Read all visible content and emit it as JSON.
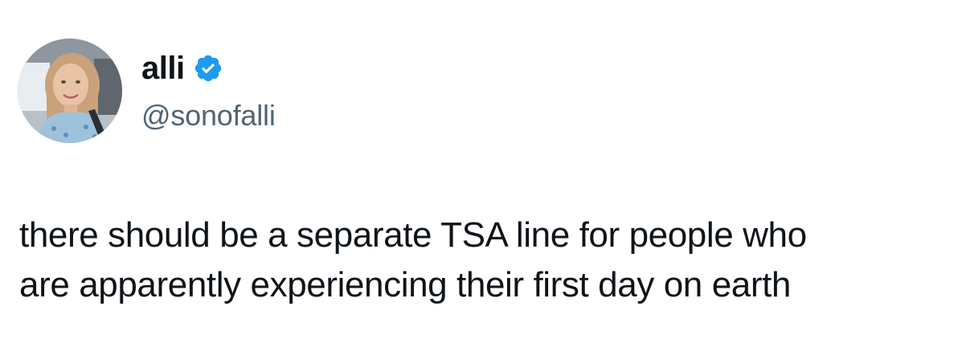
{
  "author": {
    "display_name": "alli",
    "handle": "@sonofalli",
    "verified": true,
    "avatar_icon": "profile-photo",
    "verified_icon": "verified-badge-icon",
    "verified_color": "#1d9bf0"
  },
  "tweet": {
    "lines": [
      "there should be a separate TSA line for people who",
      "are apparently experiencing their first day on earth"
    ]
  },
  "colors": {
    "text": "#0f1419",
    "secondary_text": "#536471",
    "background": "#ffffff"
  }
}
